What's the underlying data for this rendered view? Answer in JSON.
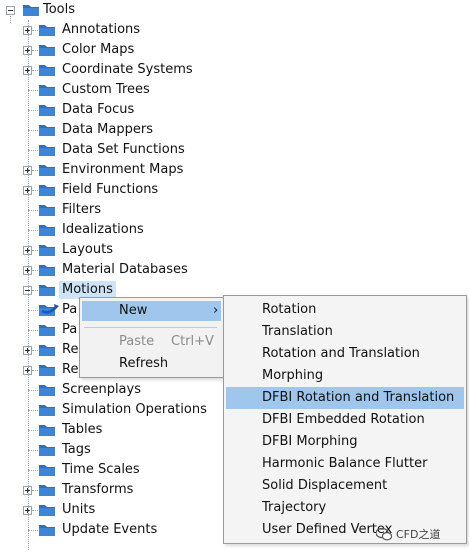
{
  "tree": {
    "root_label": "Tools",
    "items": [
      {
        "label": "Annotations",
        "expandable": true
      },
      {
        "label": "Color Maps",
        "expandable": true
      },
      {
        "label": "Coordinate Systems",
        "expandable": true
      },
      {
        "label": "Custom Trees",
        "expandable": false
      },
      {
        "label": "Data Focus",
        "expandable": false
      },
      {
        "label": "Data Mappers",
        "expandable": false
      },
      {
        "label": "Data Set Functions",
        "expandable": false
      },
      {
        "label": "Environment Maps",
        "expandable": true
      },
      {
        "label": "Field Functions",
        "expandable": true
      },
      {
        "label": "Filters",
        "expandable": false
      },
      {
        "label": "Idealizations",
        "expandable": false
      },
      {
        "label": "Layouts",
        "expandable": true
      },
      {
        "label": "Material Databases",
        "expandable": true
      },
      {
        "label": "Motions",
        "expandable": true,
        "expanded": true,
        "selected": true
      },
      {
        "label": "Pa",
        "expandable": false
      },
      {
        "label": "Pa",
        "expandable": false
      },
      {
        "label": "Re",
        "expandable": true
      },
      {
        "label": "Rendering Materials",
        "expandable": true
      },
      {
        "label": "Screenplays",
        "expandable": false
      },
      {
        "label": "Simulation Operations",
        "expandable": false
      },
      {
        "label": "Tables",
        "expandable": false
      },
      {
        "label": "Tags",
        "expandable": false
      },
      {
        "label": "Time Scales",
        "expandable": false
      },
      {
        "label": "Transforms",
        "expandable": true
      },
      {
        "label": "Units",
        "expandable": true
      },
      {
        "label": "Update Events",
        "expandable": false
      }
    ]
  },
  "context_menu": {
    "new_label": "New",
    "new_arrow": "›",
    "paste_label": "Paste",
    "paste_shortcut": "Ctrl+V",
    "refresh_label": "Refresh"
  },
  "submenu": {
    "items": [
      "Rotation",
      "Translation",
      "Rotation and Translation",
      "Morphing",
      "DFBI Rotation and Translation",
      "DFBI Embedded Rotation",
      "DFBI Morphing",
      "Harmonic Balance Flutter",
      "Solid Displacement",
      "Trajectory",
      "User Defined Vertex"
    ],
    "highlighted_index": 4
  },
  "watermark": {
    "text": "CFD之道"
  },
  "colors": {
    "folder": "#2f6fc1",
    "selection": "#cfe3f6",
    "menu_highlight": "#9fc6ec"
  }
}
